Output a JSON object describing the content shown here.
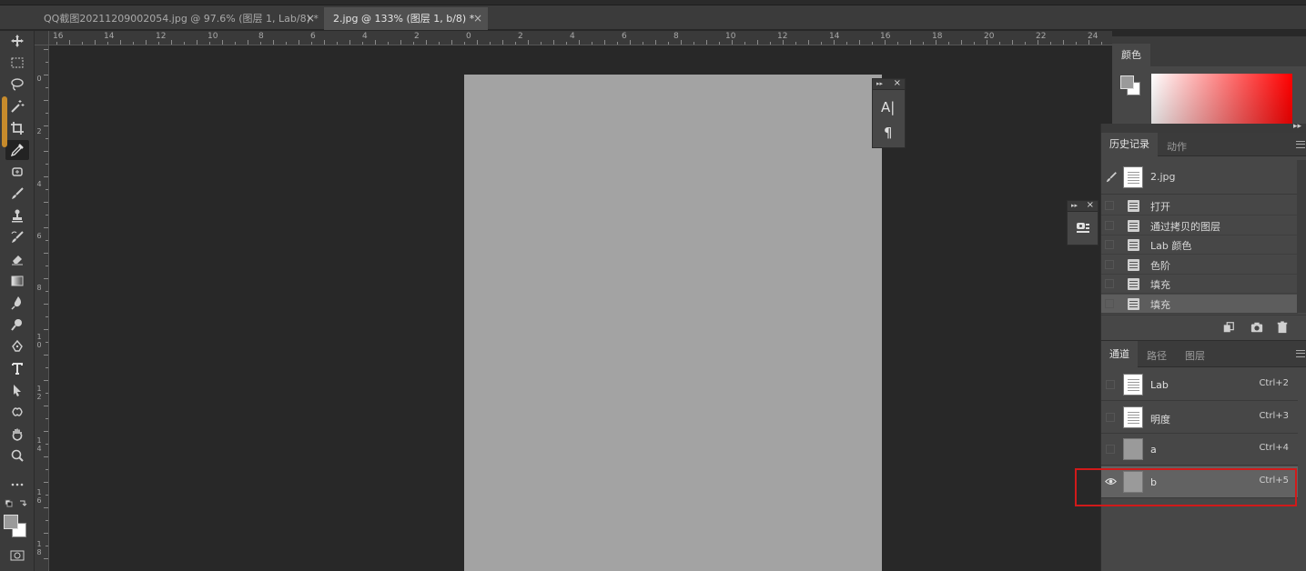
{
  "tabs": [
    {
      "label": "QQ截图20211209002054.jpg @ 97.6% (图层 1, Lab/8) *",
      "close": "×"
    },
    {
      "label": "2.jpg @ 133% (图层 1, b/8) *",
      "close": "×"
    }
  ],
  "ruler": {
    "horizontal": [
      "16",
      "14",
      "12",
      "10",
      "8",
      "6",
      "4",
      "2",
      "0",
      "2",
      "4",
      "6",
      "8",
      "10",
      "12",
      "14",
      "16",
      "18",
      "20",
      "22",
      "24"
    ],
    "vertical": [
      "0",
      "2",
      "4",
      "6",
      "8",
      "1 0",
      "1 2",
      "1 4",
      "1 6",
      "1 8"
    ]
  },
  "type_panel": {
    "icon_text": "A|",
    "icon_para": "¶"
  },
  "color_panel": {
    "tab": "颜色",
    "gradient_from": "#ffffff",
    "gradient_to": "#ff0000"
  },
  "history_panel": {
    "tabs": [
      "历史记录",
      "动作"
    ],
    "snapshot": "2.jpg",
    "items": [
      "打开",
      "通过拷贝的图层",
      "Lab 颜色",
      "色阶",
      "填充",
      "填充"
    ],
    "selected_index": 5
  },
  "channels_panel": {
    "tabs": [
      "通道",
      "路径",
      "图层"
    ],
    "channels": [
      {
        "name": "Lab",
        "shortcut": "Ctrl+2",
        "visible": false
      },
      {
        "name": "明度",
        "shortcut": "Ctrl+3",
        "visible": false
      },
      {
        "name": "a",
        "shortcut": "Ctrl+4",
        "visible": false
      },
      {
        "name": "b",
        "shortcut": "Ctrl+5",
        "visible": true
      }
    ],
    "selected_index": 3
  },
  "colors": {
    "highlight": "#d11a1a",
    "canvas": "#a3a3a3"
  }
}
